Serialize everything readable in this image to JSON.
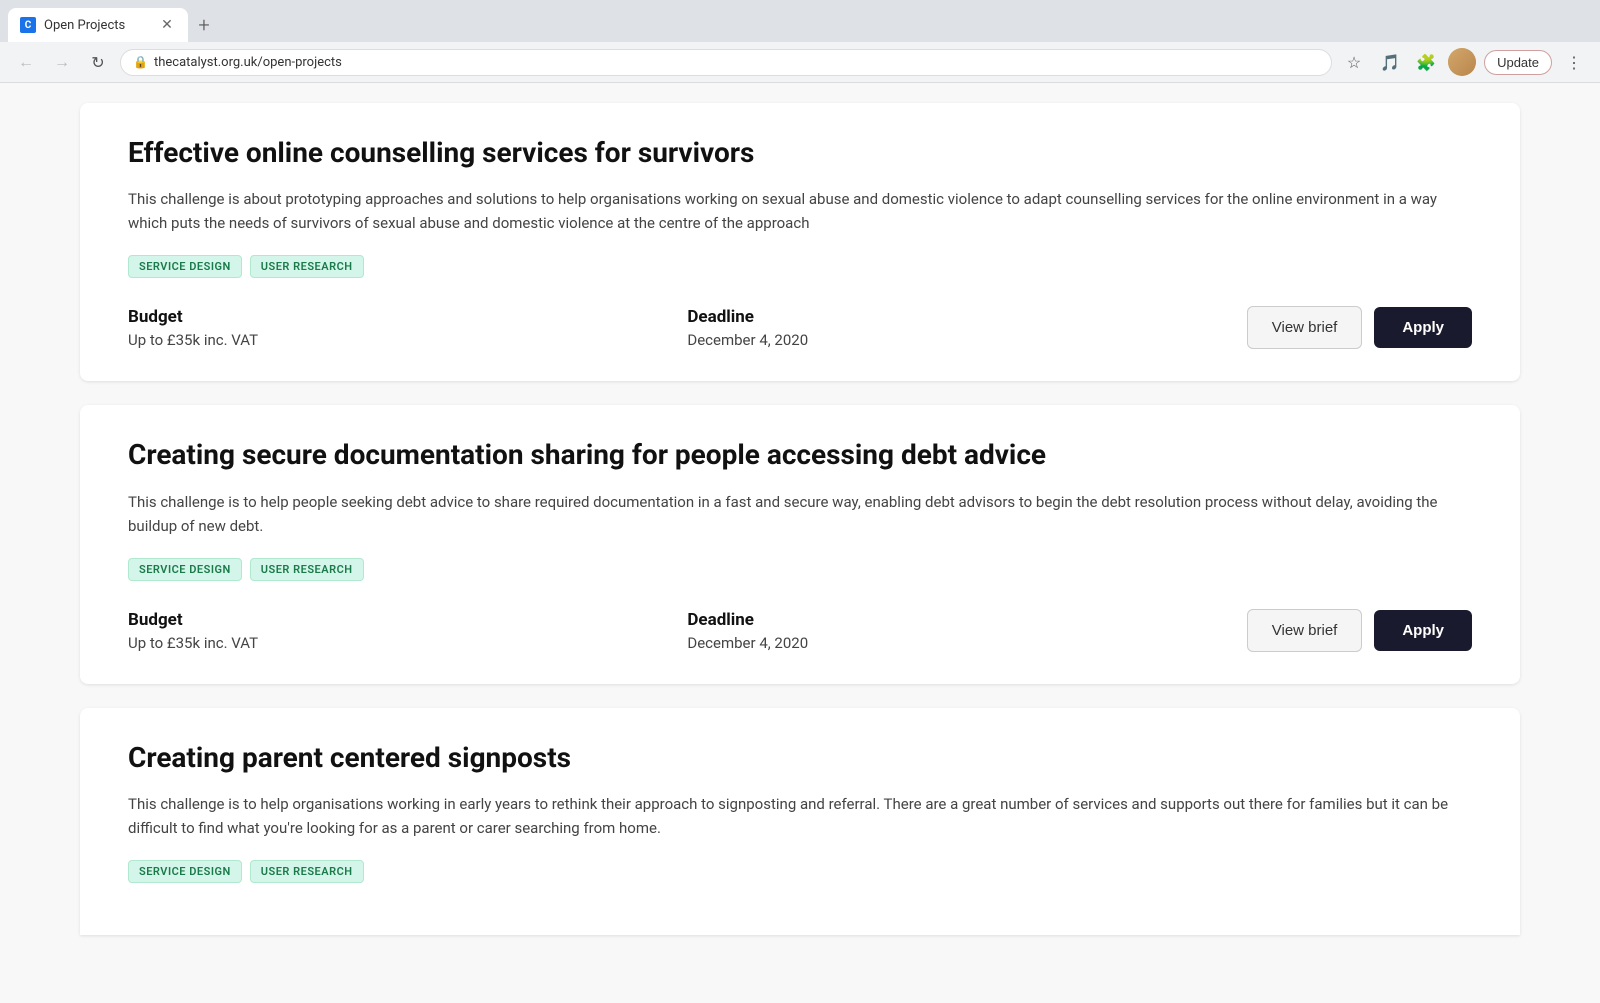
{
  "browser": {
    "tab_favicon": "C",
    "tab_title": "Open Projects",
    "url": "thecatalyst.org.uk/open-projects",
    "update_label": "Update"
  },
  "projects": [
    {
      "id": "counselling",
      "title": "Effective online counselling services for survivors",
      "description": "This challenge is about prototyping approaches and solutions to help organisations working on sexual abuse and domestic violence to adapt counselling services for the online environment in a way which puts the needs of survivors of sexual abuse and domestic violence at the centre of the approach",
      "tags": [
        "SERVICE DESIGN",
        "USER RESEARCH"
      ],
      "budget_label": "Budget",
      "budget_value": "Up to £35k inc. VAT",
      "deadline_label": "Deadline",
      "deadline_value": "December 4, 2020",
      "view_brief_label": "View brief",
      "apply_label": "Apply"
    },
    {
      "id": "debt-advice",
      "title": "Creating secure documentation sharing for people accessing debt advice",
      "description": "This challenge is to help people seeking debt advice to share required documentation in a fast and secure way, enabling debt advisors to begin the debt resolution process without delay, avoiding the buildup of new debt.",
      "tags": [
        "SERVICE DESIGN",
        "USER RESEARCH"
      ],
      "budget_label": "Budget",
      "budget_value": "Up to £35k inc. VAT",
      "deadline_label": "Deadline",
      "deadline_value": "December 4, 2020",
      "view_brief_label": "View brief",
      "apply_label": "Apply"
    },
    {
      "id": "signposts",
      "title": "Creating parent centered signposts",
      "description": "This challenge is to help organisations working in early years to rethink their approach to signposting and referral. There are a great number of services and supports out there for families but it can be difficult to find what you're looking for as a parent or carer searching from home.",
      "tags": [
        "SERVICE DESIGN",
        "USER RESEARCH"
      ]
    }
  ]
}
